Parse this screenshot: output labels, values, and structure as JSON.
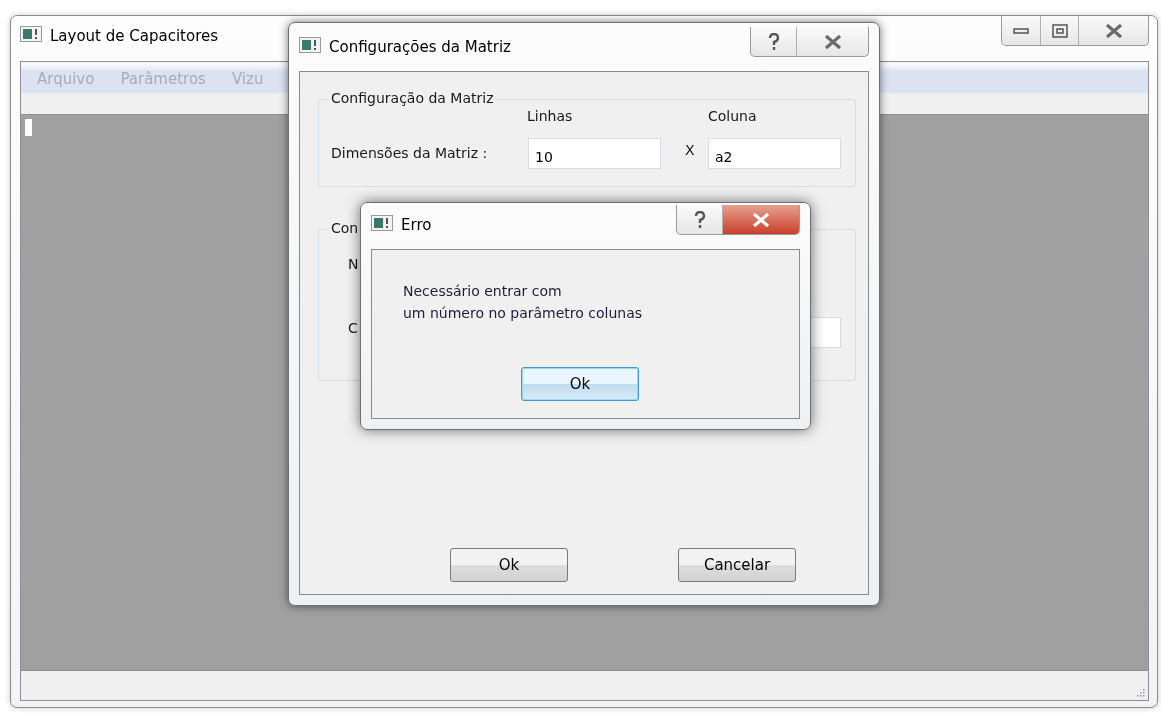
{
  "main_window": {
    "title": "Layout de Capacitores",
    "menu": [
      {
        "label": "Arquivo",
        "disabled": true
      },
      {
        "label": "Parâmetros",
        "disabled": true
      },
      {
        "label": "Vizu",
        "disabled": true
      }
    ]
  },
  "config_dialog": {
    "title": "Configurações da Matriz",
    "group_1": {
      "title": "Configuração da Matriz",
      "row_label": "Dimensões da Matriz :",
      "separator": "X",
      "columns": [
        {
          "header": "Linhas",
          "value": "10"
        },
        {
          "header": "Coluna",
          "value": "a2"
        }
      ]
    },
    "group_2": {
      "title": "Con",
      "labels": [
        "N",
        "C"
      ]
    },
    "buttons": [
      "Ok",
      "Cancelar"
    ]
  },
  "error_dialog": {
    "title": "Erro",
    "message_lines": [
      "Necessário entrar com",
      "um número no parâmetro colunas"
    ],
    "button": "Ok"
  }
}
